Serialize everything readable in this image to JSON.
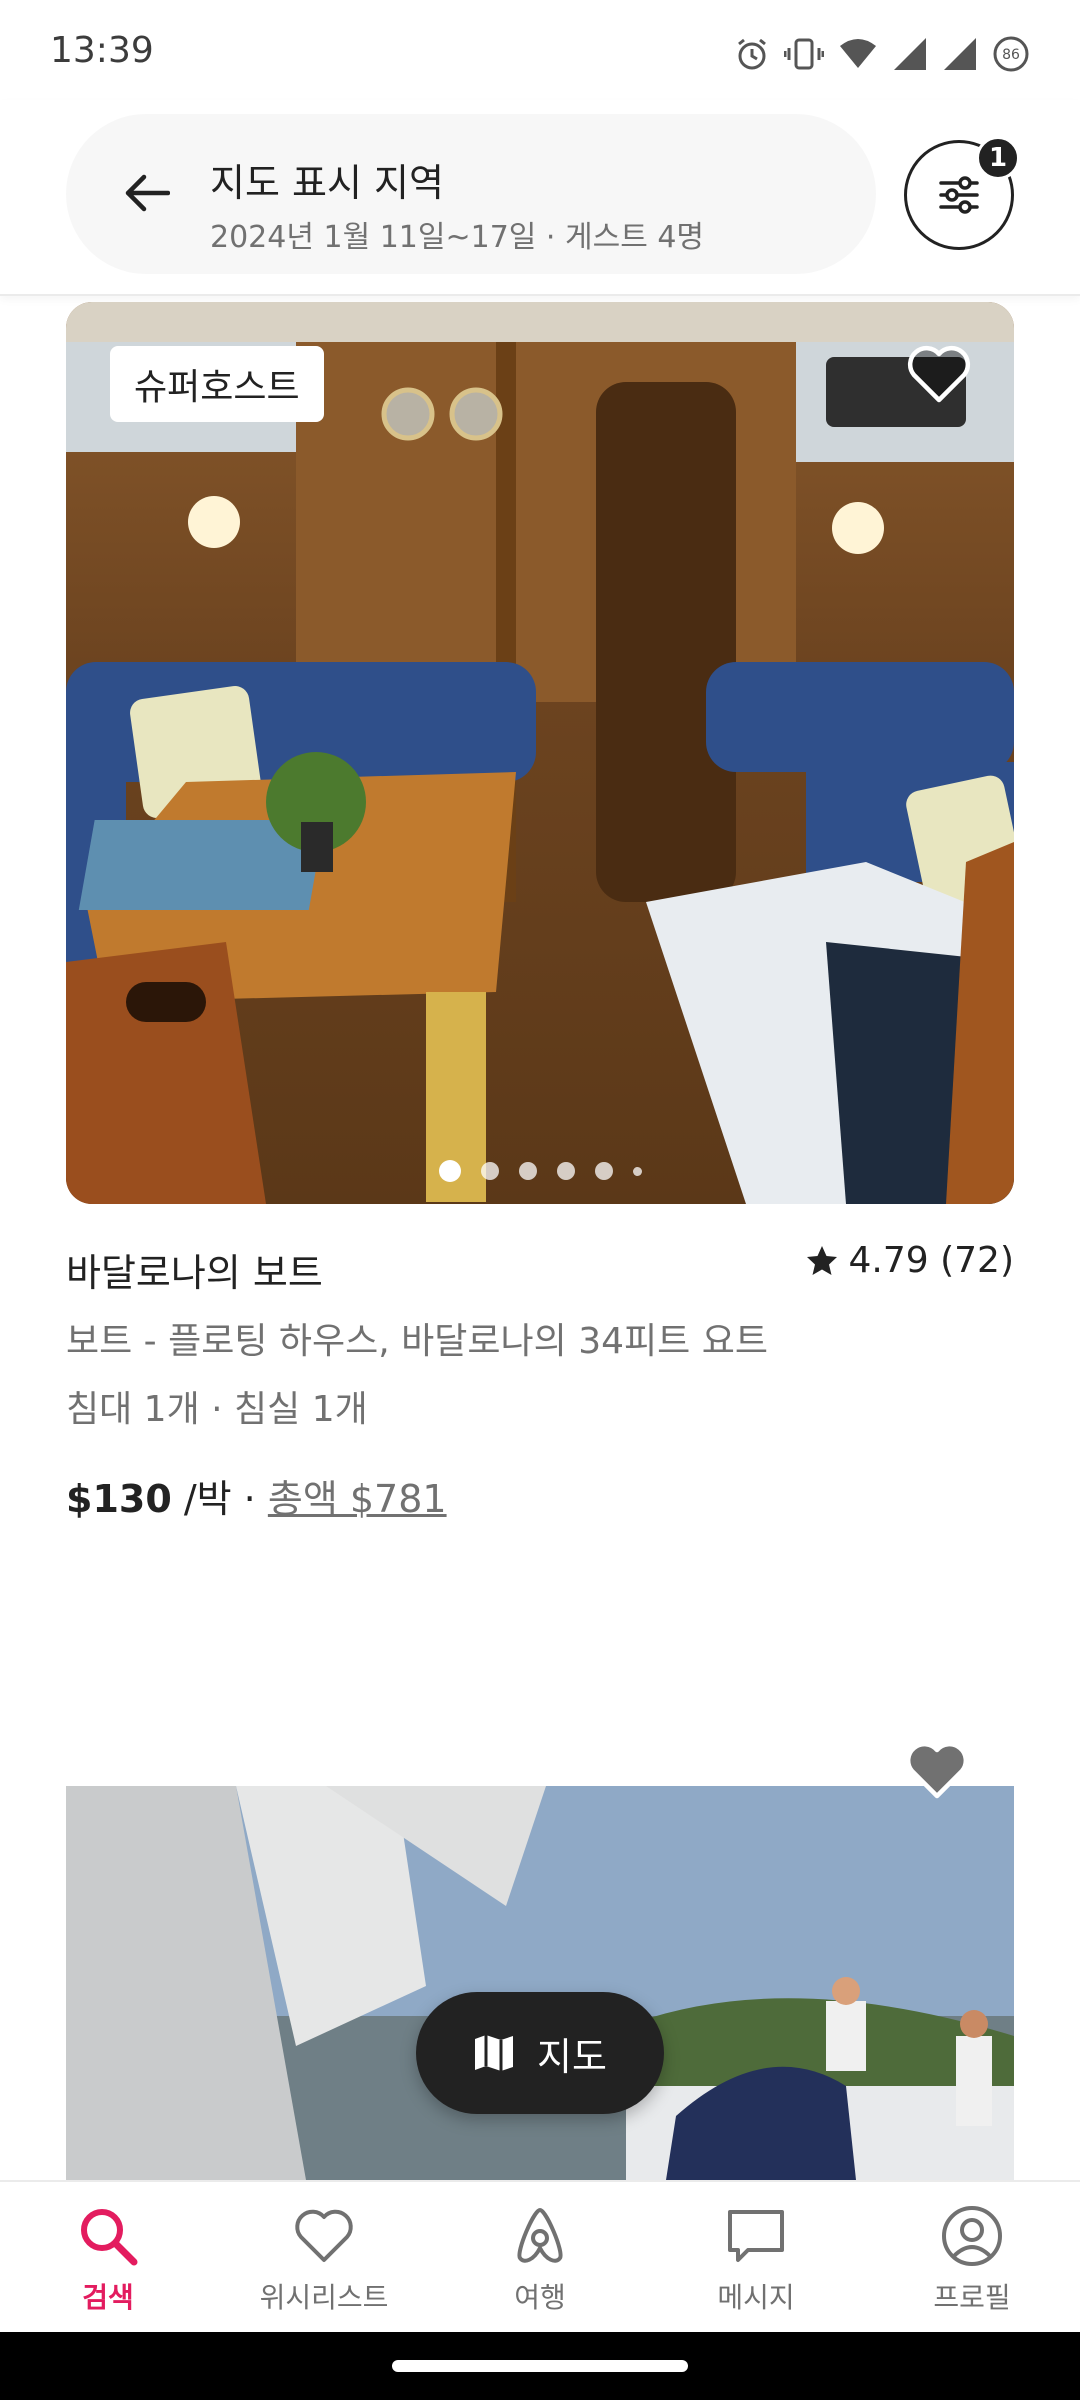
{
  "status_bar": {
    "time": "13:39",
    "battery": "86",
    "icons": [
      "alarm-icon",
      "vibrate-icon",
      "wifi-icon",
      "signal-icon",
      "signal-icon",
      "battery-icon"
    ]
  },
  "search": {
    "title": "지도 표시 지역",
    "subtitle": "2024년 1월 11일~17일 · 게스트 4명",
    "filter_count": "1"
  },
  "listing": {
    "badge": "슈퍼호스트",
    "title": "바달로나의 보트",
    "rating": "4.79 (72)",
    "description": "보트 - 플로팅 하우스, 바달로나의 34피트 요트",
    "beds": "침대 1개 · 침실 1개",
    "price": "$130",
    "price_unit": " /박 · ",
    "total": "총액 $781",
    "photo_index": 1,
    "photo_count": 6
  },
  "map_button": {
    "label": "지도"
  },
  "bottom_nav": {
    "items": [
      {
        "label": "검색",
        "icon": "search-icon",
        "active": true
      },
      {
        "label": "위시리스트",
        "icon": "heart-icon",
        "active": false
      },
      {
        "label": "여행",
        "icon": "airbnb-icon",
        "active": false
      },
      {
        "label": "메시지",
        "icon": "message-icon",
        "active": false
      },
      {
        "label": "프로필",
        "icon": "profile-icon",
        "active": false
      }
    ]
  },
  "colors": {
    "accent": "#e31c5f",
    "text": "#222222",
    "muted": "#717171"
  }
}
